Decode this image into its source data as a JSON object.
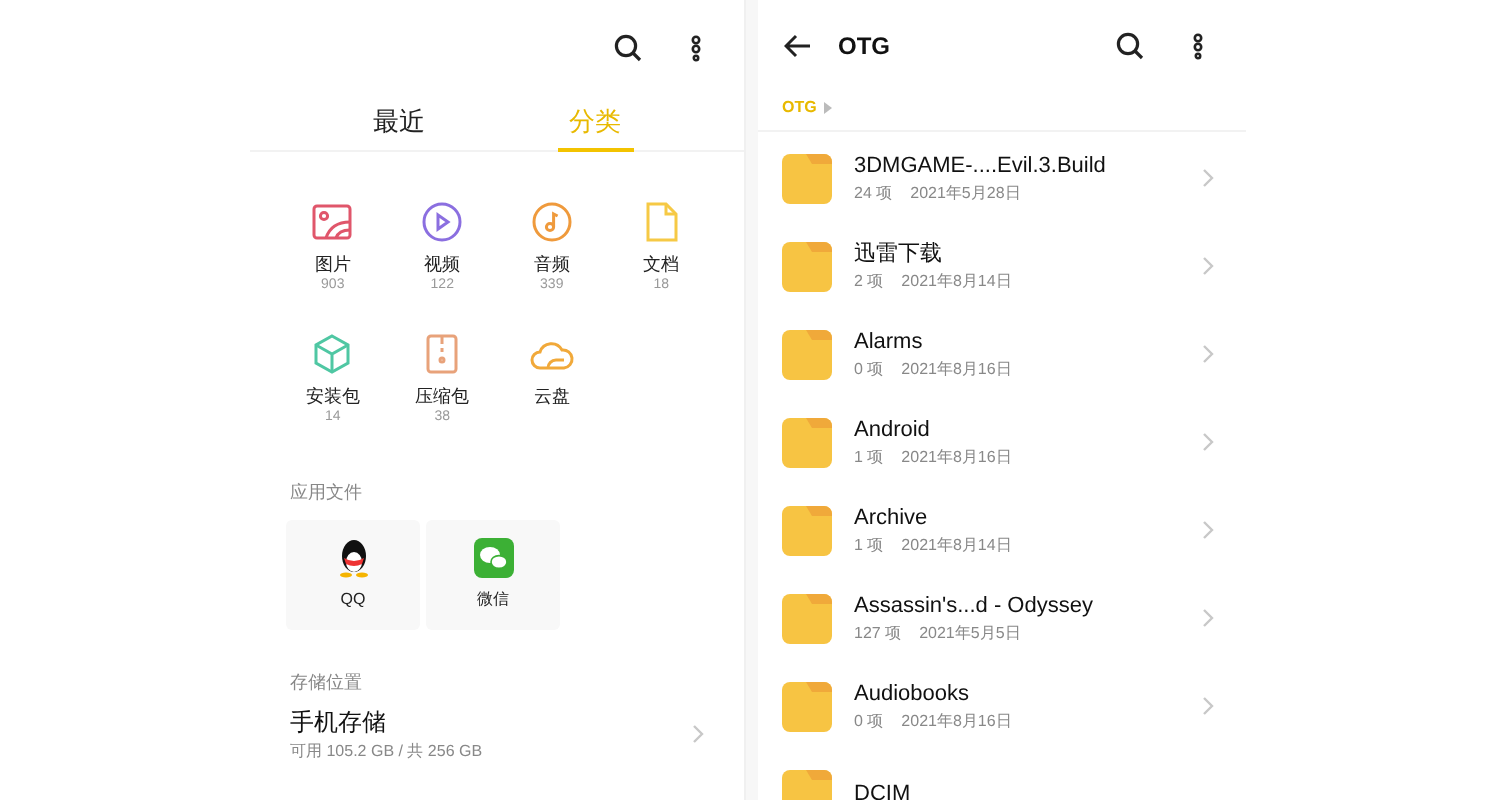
{
  "left_screen": {
    "tabs": [
      {
        "label": "最近",
        "selected": false
      },
      {
        "label": "分类",
        "selected": true
      }
    ],
    "categories": [
      {
        "kind": "image",
        "label": "图片",
        "count": "903"
      },
      {
        "kind": "video",
        "label": "视频",
        "count": "122"
      },
      {
        "kind": "audio",
        "label": "音频",
        "count": "339"
      },
      {
        "kind": "document",
        "label": "文档",
        "count": "18"
      },
      {
        "kind": "package",
        "label": "安装包",
        "count": "14"
      },
      {
        "kind": "archive",
        "label": "压缩包",
        "count": "38"
      },
      {
        "kind": "cloud",
        "label": "云盘"
      }
    ],
    "app_files": {
      "heading": "应用文件",
      "apps": [
        {
          "kind": "penguin",
          "label": "QQ"
        },
        {
          "kind": "chat",
          "label": "微信"
        }
      ]
    },
    "storage": {
      "heading": "存储位置",
      "name": "手机存储",
      "detail": "可用 105.2 GB / 共 256 GB"
    }
  },
  "right_screen": {
    "title": "OTG",
    "breadcrumb": [
      "OTG"
    ],
    "folders": [
      {
        "name": "3DMGAME-....Evil.3.Build",
        "items": "24 项",
        "date": "2021年5月28日"
      },
      {
        "name": "迅雷下载",
        "items": "2 项",
        "date": "2021年8月14日"
      },
      {
        "name": "Alarms",
        "items": "0 项",
        "date": "2021年8月16日"
      },
      {
        "name": "Android",
        "items": "1 项",
        "date": "2021年8月16日"
      },
      {
        "name": "Archive",
        "items": "1 项",
        "date": "2021年8月14日"
      },
      {
        "name": "Assassin's...d - Odyssey",
        "items": "127 项",
        "date": "2021年5月5日"
      },
      {
        "name": "Audiobooks",
        "items": "0 项",
        "date": "2021年8月16日"
      },
      {
        "name": "DCIM"
      }
    ]
  }
}
